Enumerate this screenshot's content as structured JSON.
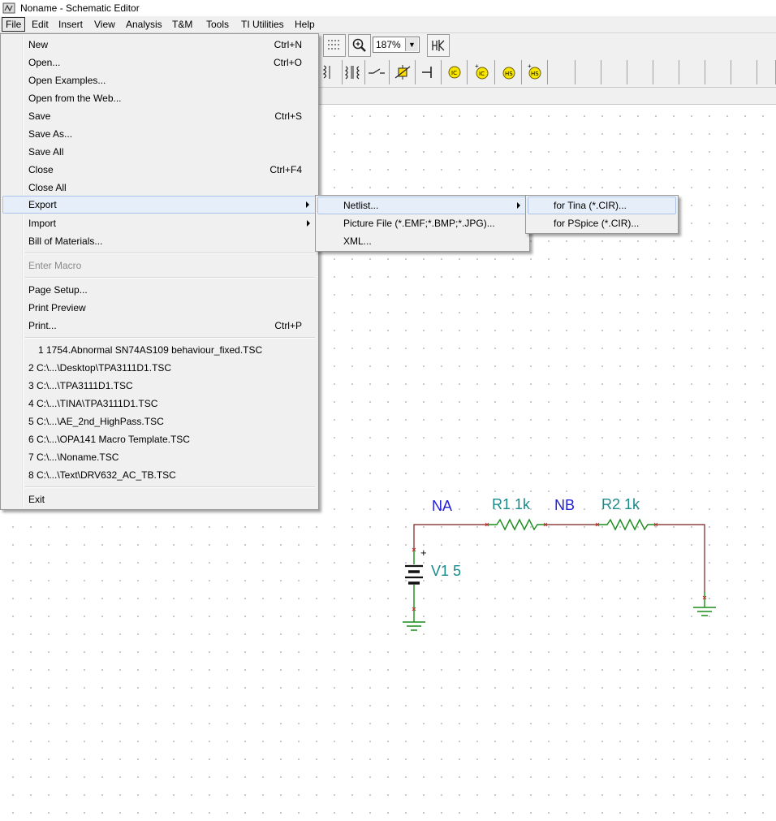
{
  "window": {
    "title": "Noname - Schematic Editor"
  },
  "menubar": [
    "File",
    "Edit",
    "Insert",
    "View",
    "Analysis",
    "T&M",
    "Tools",
    "TI Utilities",
    "Help"
  ],
  "toolbar": {
    "zoom": "187%"
  },
  "file_menu": {
    "group1": [
      {
        "label": "New",
        "shortcut": "Ctrl+N"
      },
      {
        "label": "Open...",
        "shortcut": "Ctrl+O"
      },
      {
        "label": "Open Examples...",
        "shortcut": ""
      },
      {
        "label": "Open from the Web...",
        "shortcut": ""
      },
      {
        "label": "Save",
        "shortcut": "Ctrl+S"
      },
      {
        "label": "Save As...",
        "shortcut": ""
      },
      {
        "label": "Save All",
        "shortcut": ""
      },
      {
        "label": "Close",
        "shortcut": "Ctrl+F4"
      },
      {
        "label": "Close All",
        "shortcut": ""
      },
      {
        "label": "Export",
        "shortcut": ""
      },
      {
        "label": "Import",
        "shortcut": ""
      },
      {
        "label": "Bill of Materials...",
        "shortcut": ""
      }
    ],
    "enter_macro": "Enter Macro",
    "group3": [
      {
        "label": "Page Setup...",
        "shortcut": ""
      },
      {
        "label": "Print Preview",
        "shortcut": ""
      },
      {
        "label": "Print...",
        "shortcut": "Ctrl+P"
      }
    ],
    "recent": [
      "1  1754.Abnormal SN74AS109 behaviour_fixed.TSC",
      "2  C:\\...\\Desktop\\TPA3111D1.TSC",
      "3  C:\\...\\TPA3111D1.TSC",
      "4  C:\\...\\TINA\\TPA3111D1.TSC",
      "5  C:\\...\\AE_2nd_HighPass.TSC",
      "6  C:\\...\\OPA141 Macro Template.TSC",
      "7  C:\\...\\Noname.TSC",
      "8  C:\\...\\Text\\DRV632_AC_TB.TSC"
    ],
    "exit": "Exit"
  },
  "export_menu": [
    "Netlist...",
    "Picture File (*.EMF;*.BMP;*.JPG)...",
    "XML..."
  ],
  "netlist_menu": [
    "for Tina (*.CIR)...",
    "for PSpice (*.CIR)..."
  ],
  "schematic": {
    "net_na": "NA",
    "net_nb": "NB",
    "r1": "R1 1k",
    "r2": "R2 1k",
    "v1": "V1 5",
    "plus": "+",
    "colors": {
      "wire": "#7a1f1f",
      "part": "#1a8c1a",
      "label": "#1a8a8a",
      "net": "#1f1fd6"
    }
  }
}
